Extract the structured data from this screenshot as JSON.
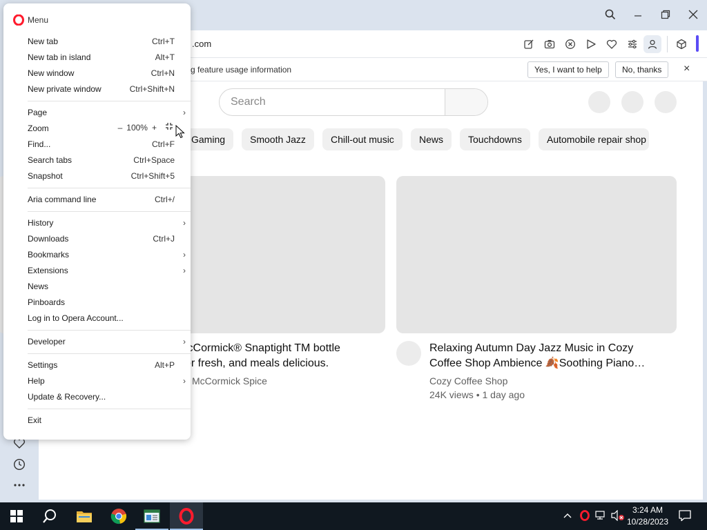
{
  "browser": {
    "url_fragment": ".com",
    "colors": {
      "accent": "#5b4cf5",
      "opera_red": "#ff1b2d"
    }
  },
  "infobar": {
    "message": "g feature usage information",
    "yes_label": "Yes, I want to help",
    "no_label": "No, thanks",
    "close_glyph": "×"
  },
  "content": {
    "search_placeholder": "Search",
    "chips": [
      "Gaming",
      "Smooth Jazz",
      "Chill-out music",
      "News",
      "Touchdowns",
      "Automobile repair shop"
    ],
    "videos": [
      {
        "title_line1": "lcCormick® Snaptight TM bottle",
        "title_line2": "or fresh, and meals delicious.",
        "channel": "McCormick Spice"
      },
      {
        "title_line1": "Relaxing Autumn Day Jazz Music in Cozy",
        "title_line2": "Coffee Shop Ambience 🍂Soothing Piano…",
        "channel": "Cozy Coffee Shop",
        "meta": "24K views • 1 day ago"
      }
    ]
  },
  "menu": {
    "title": "Menu",
    "zoom_value": "100%",
    "zoom_minus": "–",
    "zoom_plus": "+",
    "items": {
      "new_tab": {
        "label": "New tab",
        "shortcut": "Ctrl+T"
      },
      "new_tab_island": {
        "label": "New tab in island",
        "shortcut": "Alt+T"
      },
      "new_window": {
        "label": "New window",
        "shortcut": "Ctrl+N"
      },
      "new_private": {
        "label": "New private window",
        "shortcut": "Ctrl+Shift+N"
      },
      "page": {
        "label": "Page"
      },
      "zoom": {
        "label": "Zoom"
      },
      "find": {
        "label": "Find...",
        "shortcut": "Ctrl+F"
      },
      "search_tabs": {
        "label": "Search tabs",
        "shortcut": "Ctrl+Space"
      },
      "snapshot": {
        "label": "Snapshot",
        "shortcut": "Ctrl+Shift+5"
      },
      "aria": {
        "label": "Aria command line",
        "shortcut": "Ctrl+/"
      },
      "history": {
        "label": "History"
      },
      "downloads": {
        "label": "Downloads",
        "shortcut": "Ctrl+J"
      },
      "bookmarks": {
        "label": "Bookmarks"
      },
      "extensions": {
        "label": "Extensions"
      },
      "news": {
        "label": "News"
      },
      "pinboards": {
        "label": "Pinboards"
      },
      "login": {
        "label": "Log in to Opera Account..."
      },
      "developer": {
        "label": "Developer"
      },
      "settings": {
        "label": "Settings",
        "shortcut": "Alt+P"
      },
      "help": {
        "label": "Help"
      },
      "update": {
        "label": "Update & Recovery..."
      },
      "exit": {
        "label": "Exit"
      }
    },
    "arrow_glyph": "›"
  },
  "taskbar": {
    "time": "3:24 AM",
    "date": "10/28/2023",
    "apps": [
      "windows-start",
      "search",
      "file-explorer",
      "chrome",
      "app-window",
      "opera"
    ]
  }
}
